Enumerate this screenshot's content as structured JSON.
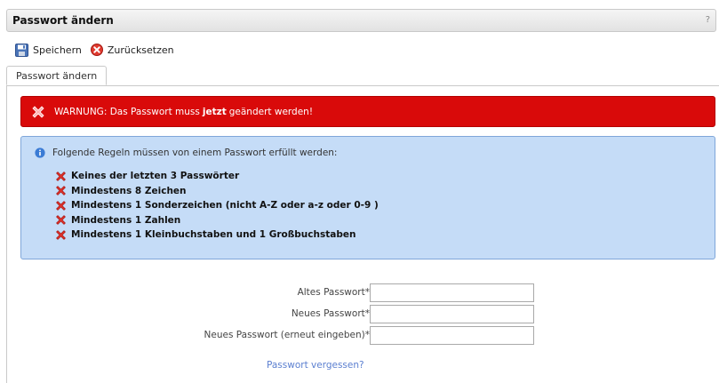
{
  "window": {
    "title": "Passwort ändern",
    "help": "?"
  },
  "toolbar": {
    "save_label": "Speichern",
    "reset_label": "Zurücksetzen"
  },
  "tabs": [
    {
      "label": "Passwort ändern"
    }
  ],
  "warning": {
    "prefix": "WARNUNG: Das Passwort muss",
    "emphasis": "jetzt",
    "suffix": "geändert werden!"
  },
  "rules": {
    "intro": "Folgende Regeln müssen von einem Passwort erfüllt werden:",
    "items": [
      "Keines der letzten 3 Passwörter",
      "Mindestens 8 Zeichen",
      "Mindestens 1 Sonderzeichen (nicht A-Z oder a-z oder 0-9 )",
      "Mindestens 1 Zahlen",
      "Mindestens 1 Kleinbuchstaben und 1 Großbuchstaben"
    ]
  },
  "form": {
    "old_password_label": "Altes Passwort*",
    "new_password_label": "Neues Passwort*",
    "repeat_password_label": "Neues Passwort (erneut eingeben)*",
    "old_password_value": "",
    "new_password_value": "",
    "repeat_password_value": ""
  },
  "forgot_link": "Passwort vergessen?",
  "colors": {
    "warning_bg": "#d90a0a",
    "info_bg": "#c5dcf7",
    "info_border": "#7fa6d9",
    "link": "#5b7fd0"
  },
  "icons": {
    "save": "floppy-disk-icon",
    "reset": "red-x-circle-icon",
    "info": "info-icon",
    "rule": "red-x-icon"
  }
}
